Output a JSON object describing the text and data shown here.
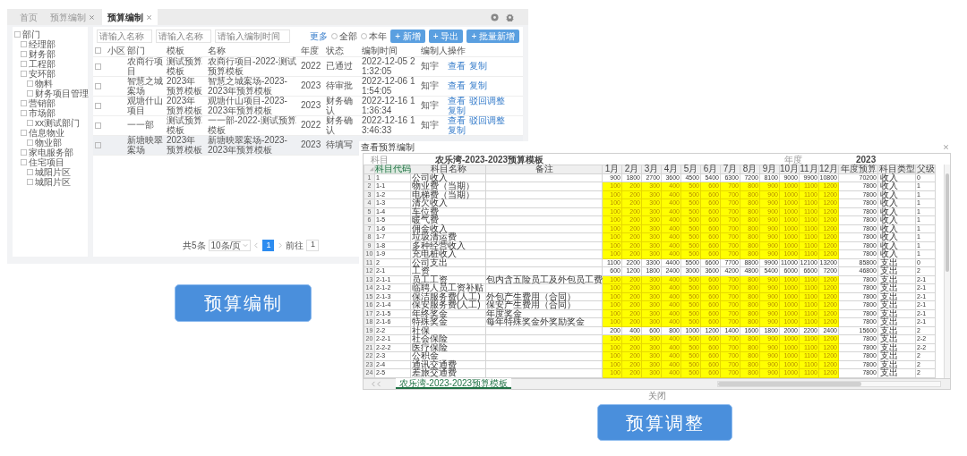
{
  "budget_list": {
    "tabs": [
      {
        "label": "首页",
        "closable": false,
        "selected": false
      },
      {
        "label": "预算编制",
        "closable": true,
        "selected": false
      },
      {
        "label": "预算编制",
        "closable": true,
        "selected": true
      }
    ],
    "tree": [
      {
        "label": "部门",
        "children": [
          {
            "label": "经理部"
          },
          {
            "label": "财务部"
          },
          {
            "label": "工程部"
          },
          {
            "label": "安环部",
            "children": [
              {
                "label": "物料"
              },
              {
                "label": "财务项目管理"
              }
            ]
          },
          {
            "label": "营销部"
          },
          {
            "label": "市场部",
            "children": [
              {
                "label": "xx测试部门"
              }
            ]
          },
          {
            "label": "信息物业",
            "children": [
              {
                "label": "物业部"
              }
            ]
          },
          {
            "label": "家电服务部"
          },
          {
            "label": "住宅项目",
            "children": [
              {
                "label": "城阳片区"
              },
              {
                "label": "城阳片区"
              }
            ]
          }
        ]
      }
    ],
    "filters": [
      {
        "placeholder": "请输入名称"
      },
      {
        "placeholder": "请输入名称"
      },
      {
        "placeholder": "请输入编制时间"
      }
    ],
    "more": "更多",
    "radios": [
      {
        "label": "全部",
        "selected": false
      },
      {
        "label": "本年",
        "selected": false
      }
    ],
    "buttons": [
      "+ 新增",
      "+ 导出",
      "+ 批量新增"
    ],
    "columns": [
      "小区",
      "部门",
      "模板",
      "名称",
      "年度",
      "状态",
      "编制时间",
      "编制人",
      "操作"
    ],
    "all_checked": false,
    "rows": [
      {
        "checked": false,
        "cells": [
          "",
          "农商行项目",
          "测试预算模板",
          "农商行项目-2022-测试预算模板",
          "2022",
          "已通过",
          "2022-12-05 21:32:05",
          "知宇"
        ],
        "actions": [
          "查看",
          "复制"
        ],
        "highlighted": false
      },
      {
        "checked": false,
        "cells": [
          "",
          "智慧之城案场",
          "2023年预算模板",
          "智慧之城案场-2023-2023年预算模板",
          "2023",
          "待审批",
          "2022-12-06 11:54:05",
          "知宇"
        ],
        "actions": [
          "查看",
          "复制"
        ],
        "highlighted": false
      },
      {
        "checked": false,
        "cells": [
          "",
          "观塘什山项目",
          "2023年预算模板",
          "观塘什山项目-2023-2023年预算模板",
          "2023",
          "财务确认",
          "2022-12-16 11:36:34",
          "知宇"
        ],
        "actions": [
          "查看",
          "驳回调整",
          "复制"
        ],
        "highlighted": false
      },
      {
        "checked": false,
        "cells": [
          "",
          "一一部",
          "测试预算模板",
          "一一部-2022-测试预算模板",
          "2022",
          "财务确认",
          "2022-12-16 13:46:33",
          "知宇"
        ],
        "actions": [
          "查看",
          "驳回调整",
          "复制"
        ],
        "highlighted": false
      },
      {
        "checked": false,
        "cells": [
          "",
          "新塘映翠案场",
          "2023年预算模板",
          "新塘映翠案场-2023-2023年预算模板",
          "2023",
          "待填写"
        ],
        "highlighted": true
      }
    ],
    "pagination": {
      "total": "共5条",
      "page_size": "10条/页",
      "pages": [
        {
          "label": "1",
          "selected": true
        }
      ],
      "goto_label": "前往",
      "goto_value": "1"
    },
    "caption": "预算编制"
  },
  "budget_view": {
    "title": "查看预算编制",
    "subject_label": "科目",
    "sheet_title": "农乐湾-2023-2023预算模板",
    "year_label": "年度",
    "year": "2023",
    "columns": [
      "科目代码",
      "科目名称",
      "备注",
      "1月",
      "2月",
      "3月",
      "4月",
      "5月",
      "6月",
      "7月",
      "8月",
      "9月",
      "10月",
      "11月",
      "12月",
      "年度预算",
      "科目类型",
      "父级"
    ],
    "rows": [
      {
        "row_number": "1",
        "code": "1",
        "name": "公司收入",
        "months": [
          "900",
          "1800",
          "2700",
          "3600",
          "4500",
          "5400",
          "6300",
          "7200",
          "8100",
          "9000",
          "9900",
          "10800"
        ],
        "total": "70200",
        "type": "收入",
        "parent": "0",
        "editable": false
      },
      {
        "row_number": "2",
        "code": "1-1",
        "name": "物业费（当期）",
        "months": [
          "100",
          "200",
          "300",
          "400",
          "500",
          "600",
          "700",
          "800",
          "900",
          "1000",
          "1100",
          "1200"
        ],
        "total": "7800",
        "type": "收入",
        "parent": "1",
        "editable": true
      },
      {
        "row_number": "3",
        "code": "1-2",
        "name": "电梯费（当期）",
        "months": [
          "100",
          "200",
          "300",
          "400",
          "500",
          "600",
          "700",
          "800",
          "900",
          "1000",
          "1100",
          "1200"
        ],
        "total": "7800",
        "type": "收入",
        "parent": "1",
        "editable": true
      },
      {
        "row_number": "4",
        "code": "1-3",
        "name": "清欠收入",
        "months": [
          "100",
          "200",
          "300",
          "400",
          "500",
          "600",
          "700",
          "800",
          "900",
          "1000",
          "1100",
          "1200"
        ],
        "total": "7800",
        "type": "收入",
        "parent": "1",
        "editable": true
      },
      {
        "row_number": "5",
        "code": "1-4",
        "name": "车位费",
        "months": [
          "100",
          "200",
          "300",
          "400",
          "500",
          "600",
          "700",
          "800",
          "900",
          "1000",
          "1100",
          "1200"
        ],
        "total": "7800",
        "type": "收入",
        "parent": "1",
        "editable": true
      },
      {
        "row_number": "6",
        "code": "1-5",
        "name": "暖气费",
        "months": [
          "100",
          "200",
          "300",
          "400",
          "500",
          "600",
          "700",
          "800",
          "900",
          "1000",
          "1100",
          "1200"
        ],
        "total": "7800",
        "type": "收入",
        "parent": "1",
        "editable": true
      },
      {
        "row_number": "7",
        "code": "1-6",
        "name": "佣金收入",
        "months": [
          "100",
          "200",
          "300",
          "400",
          "500",
          "600",
          "700",
          "800",
          "900",
          "1000",
          "1100",
          "1200"
        ],
        "total": "7800",
        "type": "收入",
        "parent": "1",
        "editable": true
      },
      {
        "row_number": "8",
        "code": "1-7",
        "name": "垃圾清运费",
        "months": [
          "100",
          "200",
          "300",
          "400",
          "500",
          "600",
          "700",
          "800",
          "900",
          "1000",
          "1100",
          "1200"
        ],
        "total": "7800",
        "type": "收入",
        "parent": "1",
        "editable": true
      },
      {
        "row_number": "9",
        "code": "1-8",
        "name": "多种经营收入",
        "months": [
          "100",
          "200",
          "300",
          "400",
          "500",
          "600",
          "700",
          "800",
          "900",
          "1000",
          "1100",
          "1200"
        ],
        "total": "7800",
        "type": "收入",
        "parent": "1",
        "editable": true
      },
      {
        "row_number": "10",
        "code": "1-9",
        "name": "充电桩收入",
        "months": [
          "100",
          "200",
          "300",
          "400",
          "500",
          "600",
          "700",
          "800",
          "900",
          "1000",
          "1100",
          "1200"
        ],
        "total": "7800",
        "type": "收入",
        "parent": "1",
        "editable": true
      },
      {
        "row_number": "11",
        "code": "2",
        "name": "公司支出",
        "months": [
          "1100",
          "2200",
          "3300",
          "4400",
          "5500",
          "6600",
          "7700",
          "8800",
          "9900",
          "11000",
          "12100",
          "13200"
        ],
        "total": "85800",
        "type": "支出",
        "parent": "0",
        "editable": false
      },
      {
        "row_number": "12",
        "code": "2-1",
        "name": "工资",
        "months": [
          "600",
          "1200",
          "1800",
          "2400",
          "3000",
          "3600",
          "4200",
          "4800",
          "5400",
          "6000",
          "6600",
          "7200"
        ],
        "total": "46800",
        "type": "支出",
        "parent": "2",
        "editable": false
      },
      {
        "row_number": "13",
        "code": "2-1-1",
        "name": "员工工资",
        "note": "包内含五险员工及外包员工费",
        "months": [
          "100",
          "200",
          "300",
          "400",
          "500",
          "600",
          "700",
          "800",
          "900",
          "1000",
          "1100",
          "1200"
        ],
        "total": "7800",
        "type": "支出",
        "parent": "2-1",
        "editable": true
      },
      {
        "row_number": "14",
        "code": "2-1-2",
        "name": "临聘人员工资补贴",
        "months": [
          "100",
          "200",
          "300",
          "400",
          "500",
          "600",
          "700",
          "800",
          "900",
          "1000",
          "1100",
          "1200"
        ],
        "total": "7800",
        "type": "支出",
        "parent": "2-1",
        "editable": true
      },
      {
        "row_number": "15",
        "code": "2-1-3",
        "name": "保洁服务费(人工)",
        "note": "外包产生费用（合同）",
        "months": [
          "100",
          "200",
          "300",
          "400",
          "500",
          "600",
          "700",
          "800",
          "900",
          "1000",
          "1100",
          "1200"
        ],
        "total": "7800",
        "type": "支出",
        "parent": "2-1",
        "editable": true
      },
      {
        "row_number": "16",
        "code": "2-1-4",
        "name": "保安服务费(人工)",
        "note": "保安产生费用（合同）",
        "months": [
          "100",
          "200",
          "300",
          "400",
          "500",
          "600",
          "700",
          "800",
          "900",
          "1000",
          "1100",
          "1200"
        ],
        "total": "7800",
        "type": "支出",
        "parent": "2-1",
        "editable": true
      },
      {
        "row_number": "17",
        "code": "2-1-5",
        "name": "年终奖金",
        "note": "年度奖金",
        "months": [
          "100",
          "200",
          "300",
          "400",
          "500",
          "600",
          "700",
          "800",
          "900",
          "1000",
          "1100",
          "1200"
        ],
        "total": "7800",
        "type": "支出",
        "parent": "2-1",
        "editable": true
      },
      {
        "row_number": "18",
        "code": "2-1-6",
        "name": "特殊奖金",
        "note": "每年特殊奖金外奖励奖金",
        "months": [
          "100",
          "200",
          "300",
          "400",
          "500",
          "600",
          "700",
          "800",
          "900",
          "1000",
          "1100",
          "1200"
        ],
        "total": "7800",
        "type": "支出",
        "parent": "2-1",
        "editable": true
      },
      {
        "row_number": "19",
        "code": "2-2",
        "name": "社保",
        "months": [
          "200",
          "400",
          "600",
          "800",
          "1000",
          "1200",
          "1400",
          "1600",
          "1800",
          "2000",
          "2200",
          "2400"
        ],
        "total": "15600",
        "type": "支出",
        "parent": "2",
        "editable": false
      },
      {
        "row_number": "20",
        "code": "2-2-1",
        "name": "社会保险",
        "months": [
          "100",
          "200",
          "300",
          "400",
          "500",
          "600",
          "700",
          "800",
          "900",
          "1000",
          "1100",
          "1200"
        ],
        "total": "7800",
        "type": "支出",
        "parent": "2-2",
        "editable": true
      },
      {
        "row_number": "21",
        "code": "2-2-2",
        "name": "医疗保险",
        "months": [
          "100",
          "200",
          "300",
          "400",
          "500",
          "600",
          "700",
          "800",
          "900",
          "1000",
          "1100",
          "1200"
        ],
        "total": "7800",
        "type": "支出",
        "parent": "2-2",
        "editable": true
      },
      {
        "row_number": "22",
        "code": "2-3",
        "name": "公积金",
        "months": [
          "100",
          "200",
          "300",
          "400",
          "500",
          "600",
          "700",
          "800",
          "900",
          "1000",
          "1100",
          "1200"
        ],
        "total": "7800",
        "type": "支出",
        "parent": "2",
        "editable": true
      },
      {
        "row_number": "23",
        "code": "2-4",
        "name": "通讯交通费",
        "months": [
          "100",
          "200",
          "300",
          "400",
          "500",
          "600",
          "700",
          "800",
          "900",
          "1000",
          "1100",
          "1200"
        ],
        "total": "7800",
        "type": "支出",
        "parent": "2",
        "editable": true
      },
      {
        "row_number": "24",
        "code": "2-5",
        "name": "差旅交通费",
        "months": [
          "100",
          "200",
          "300",
          "400",
          "500",
          "600",
          "700",
          "800",
          "900",
          "1000",
          "1100",
          "1200"
        ],
        "total": "7800",
        "type": "支出",
        "parent": "2",
        "editable": true
      }
    ],
    "sheet_tab": "农乐湾-2023-2023预算模板",
    "close": "关闭",
    "caption": "预算调整"
  }
}
